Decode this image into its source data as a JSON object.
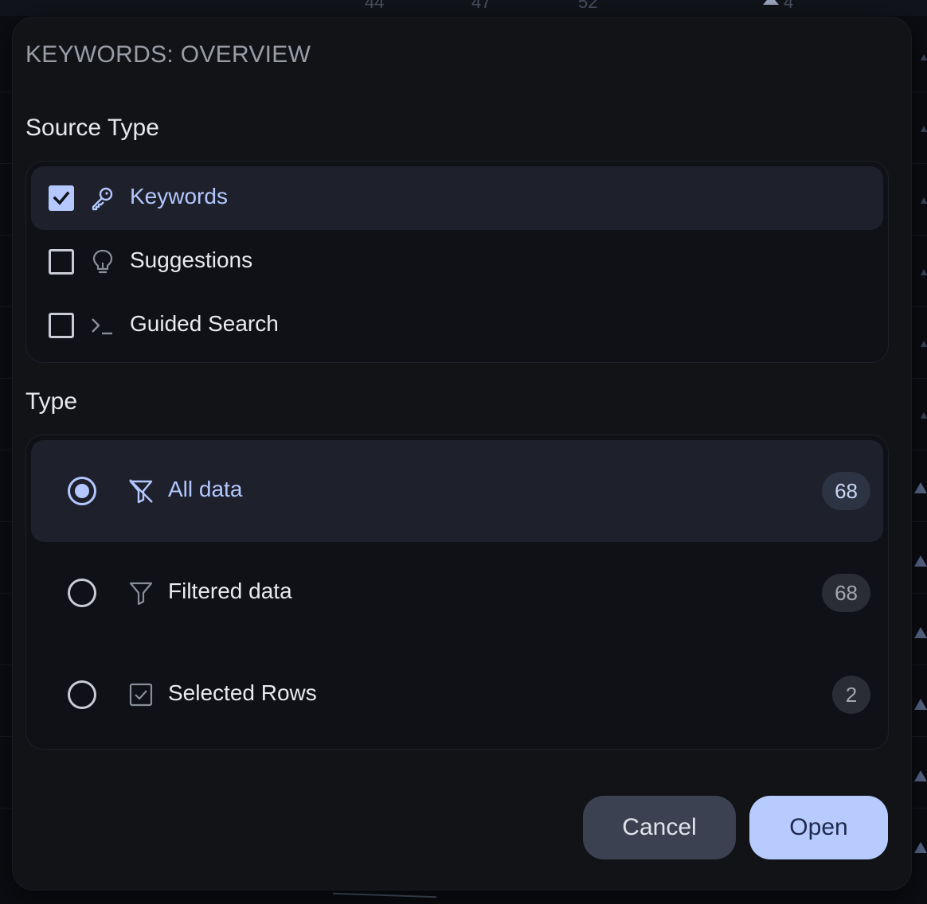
{
  "background": {
    "top_numbers": [
      "44",
      "47",
      "52",
      "4"
    ]
  },
  "dialog": {
    "title": "KEYWORDS: OVERVIEW",
    "source_type": {
      "heading": "Source Type",
      "options": [
        {
          "label": "Keywords",
          "icon": "key-icon",
          "checked": true
        },
        {
          "label": "Suggestions",
          "icon": "lightbulb-icon",
          "checked": false
        },
        {
          "label": "Guided Search",
          "icon": "terminal-icon",
          "checked": false
        }
      ]
    },
    "type": {
      "heading": "Type",
      "options": [
        {
          "label": "All data",
          "icon": "filter-off-icon",
          "count": "68",
          "selected": true
        },
        {
          "label": "Filtered data",
          "icon": "filter-icon",
          "count": "68",
          "selected": false
        },
        {
          "label": "Selected Rows",
          "icon": "checkbox-square-icon",
          "count": "2",
          "selected": false
        }
      ]
    },
    "buttons": {
      "cancel": "Cancel",
      "open": "Open"
    }
  },
  "colors": {
    "accent": "#b4c8ff",
    "dialog_bg": "#111317",
    "active_row_bg": "#1e212c"
  }
}
